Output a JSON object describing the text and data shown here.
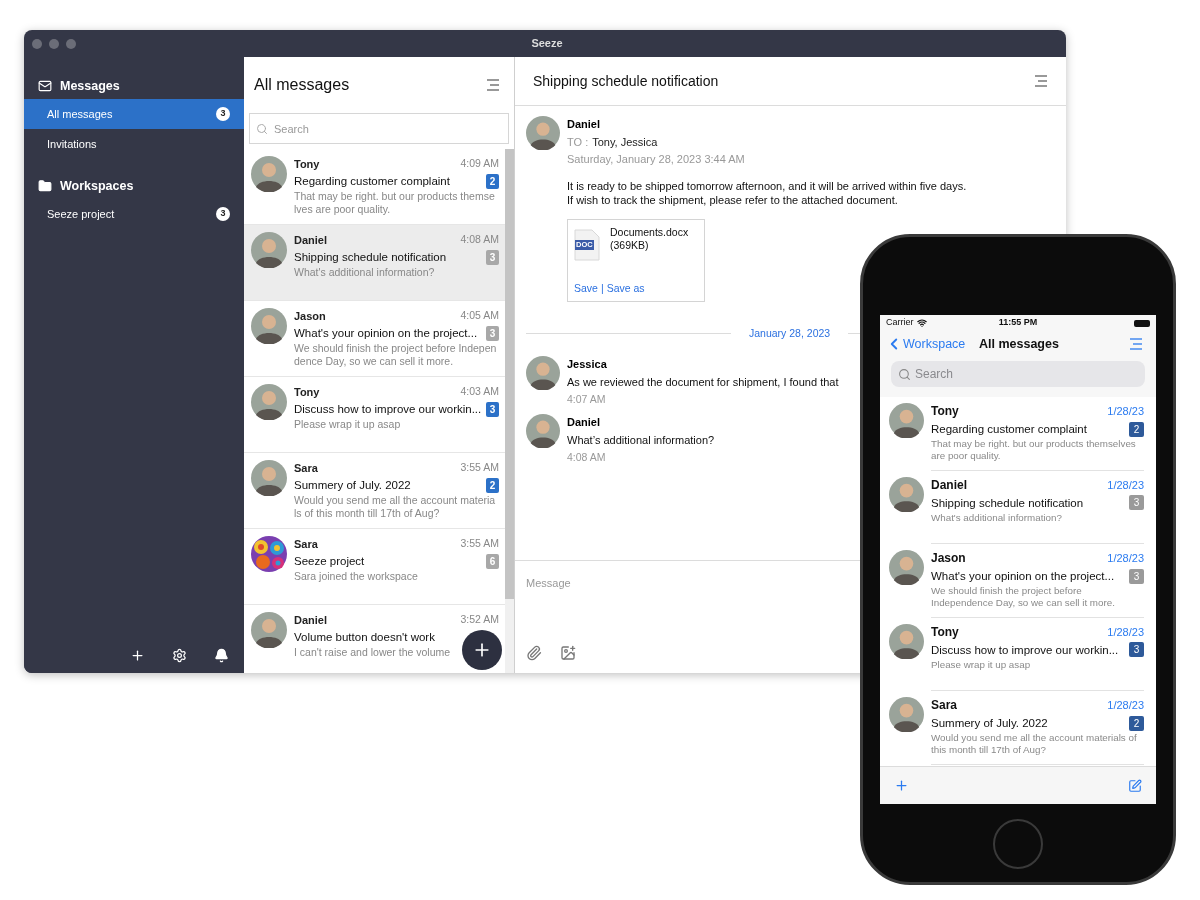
{
  "window": {
    "title": "Seeze"
  },
  "sidebar": {
    "sections": [
      {
        "title": "Messages",
        "items": [
          {
            "label": "All messages",
            "badge": "3",
            "selected": true
          },
          {
            "label": "Invitations",
            "selected": false
          }
        ]
      },
      {
        "title": "Workspaces",
        "items": [
          {
            "label": "Seeze project",
            "badge": "3",
            "selected": false
          }
        ]
      }
    ]
  },
  "list": {
    "title": "All messages",
    "search": {
      "placeholder": "Search"
    },
    "messages": [
      {
        "sender": "Tony",
        "time": "4:09 AM",
        "subject": "Regarding customer complaint",
        "preview": "That may be right. but our products themselves are poor quality.",
        "count": "2",
        "unread": true,
        "selected": false,
        "kind": "person"
      },
      {
        "sender": "Daniel",
        "time": "4:08 AM",
        "subject": "Shipping schedule notification",
        "preview": "What's additional information?",
        "count": "3",
        "unread": false,
        "selected": true,
        "kind": "person"
      },
      {
        "sender": "Jason",
        "time": "4:05 AM",
        "subject": "What's your opinion on the project...",
        "preview": "We should finish the project before Independence Day, so we can sell it more.",
        "count": "3",
        "unread": false,
        "selected": false,
        "kind": "person"
      },
      {
        "sender": "Tony",
        "time": "4:03 AM",
        "subject": "Discuss how to improve our workin...",
        "preview": "Please wrap it up asap",
        "count": "3",
        "unread": true,
        "selected": false,
        "kind": "person"
      },
      {
        "sender": "Sara",
        "time": "3:55 AM",
        "subject": "Summery of July. 2022",
        "preview": "Would you send me all the account materials of this month till 17th of Aug?",
        "count": "2",
        "unread": true,
        "selected": false,
        "kind": "person"
      },
      {
        "sender": "Sara",
        "time": "3:55 AM",
        "subject": "Seeze project",
        "preview": "Sara joined the workspace",
        "count": "6",
        "unread": false,
        "selected": false,
        "kind": "pattern"
      },
      {
        "sender": "Daniel",
        "time": "3:52 AM",
        "subject": "Volume button doesn't work",
        "preview": "I can't raise and lower the volume",
        "selected": false,
        "kind": "person"
      }
    ]
  },
  "detail": {
    "title": "Shipping schedule notification",
    "message": {
      "sender": "Daniel",
      "to_label": "TO :",
      "to": "Tony, Jessica",
      "date": "Saturday, January 28, 2023 3:44 AM",
      "body": [
        "It is ready to be shipped tomorrow afternoon, and it will be arrived within five days.",
        "If wish to track the shipment, please refer to the attached document."
      ],
      "attachment": {
        "type_label": "DOC",
        "name": "Documents.docx",
        "size": "(369KB)",
        "actions": [
          "Save",
          "Save as"
        ],
        "separator": "|"
      }
    },
    "date_divider": "January 28, 2023",
    "replies": [
      {
        "sender": "Jessica",
        "text": "As we reviewed the document for shipment, I found that",
        "time": "4:07 AM"
      },
      {
        "sender": "Daniel",
        "text": "What’s additional information?",
        "time": "4:08 AM"
      }
    ],
    "composer": {
      "placeholder": "Message"
    }
  },
  "phone": {
    "status_bar": {
      "carrier": "Carrier",
      "time": "11:55 PM"
    },
    "nav": {
      "back": "Workspace",
      "title": "All messages"
    },
    "search": {
      "placeholder": "Search"
    },
    "messages": [
      {
        "sender": "Tony",
        "date": "1/28/23",
        "subject": "Regarding customer complaint",
        "preview": "That may be right. but our products themselves are poor quality.",
        "count": "2",
        "unread": true
      },
      {
        "sender": "Daniel",
        "date": "1/28/23",
        "subject": "Shipping schedule notification",
        "preview": "What's additional information?",
        "count": "3",
        "unread": false
      },
      {
        "sender": "Jason",
        "date": "1/28/23",
        "subject": "What's your opinion on the project...",
        "preview": "We should finish the project before Independence Day, so we can sell it more.",
        "count": "3",
        "unread": false
      },
      {
        "sender": "Tony",
        "date": "1/28/23",
        "subject": "Discuss how to improve our workin...",
        "preview": "Please wrap it up asap",
        "count": "3",
        "unread": true
      },
      {
        "sender": "Sara",
        "date": "1/28/23",
        "subject": "Summery of July. 2022",
        "preview": "Would you send me all the account materials of this month till 17th of Aug?",
        "count": "2",
        "unread": true
      }
    ]
  }
}
